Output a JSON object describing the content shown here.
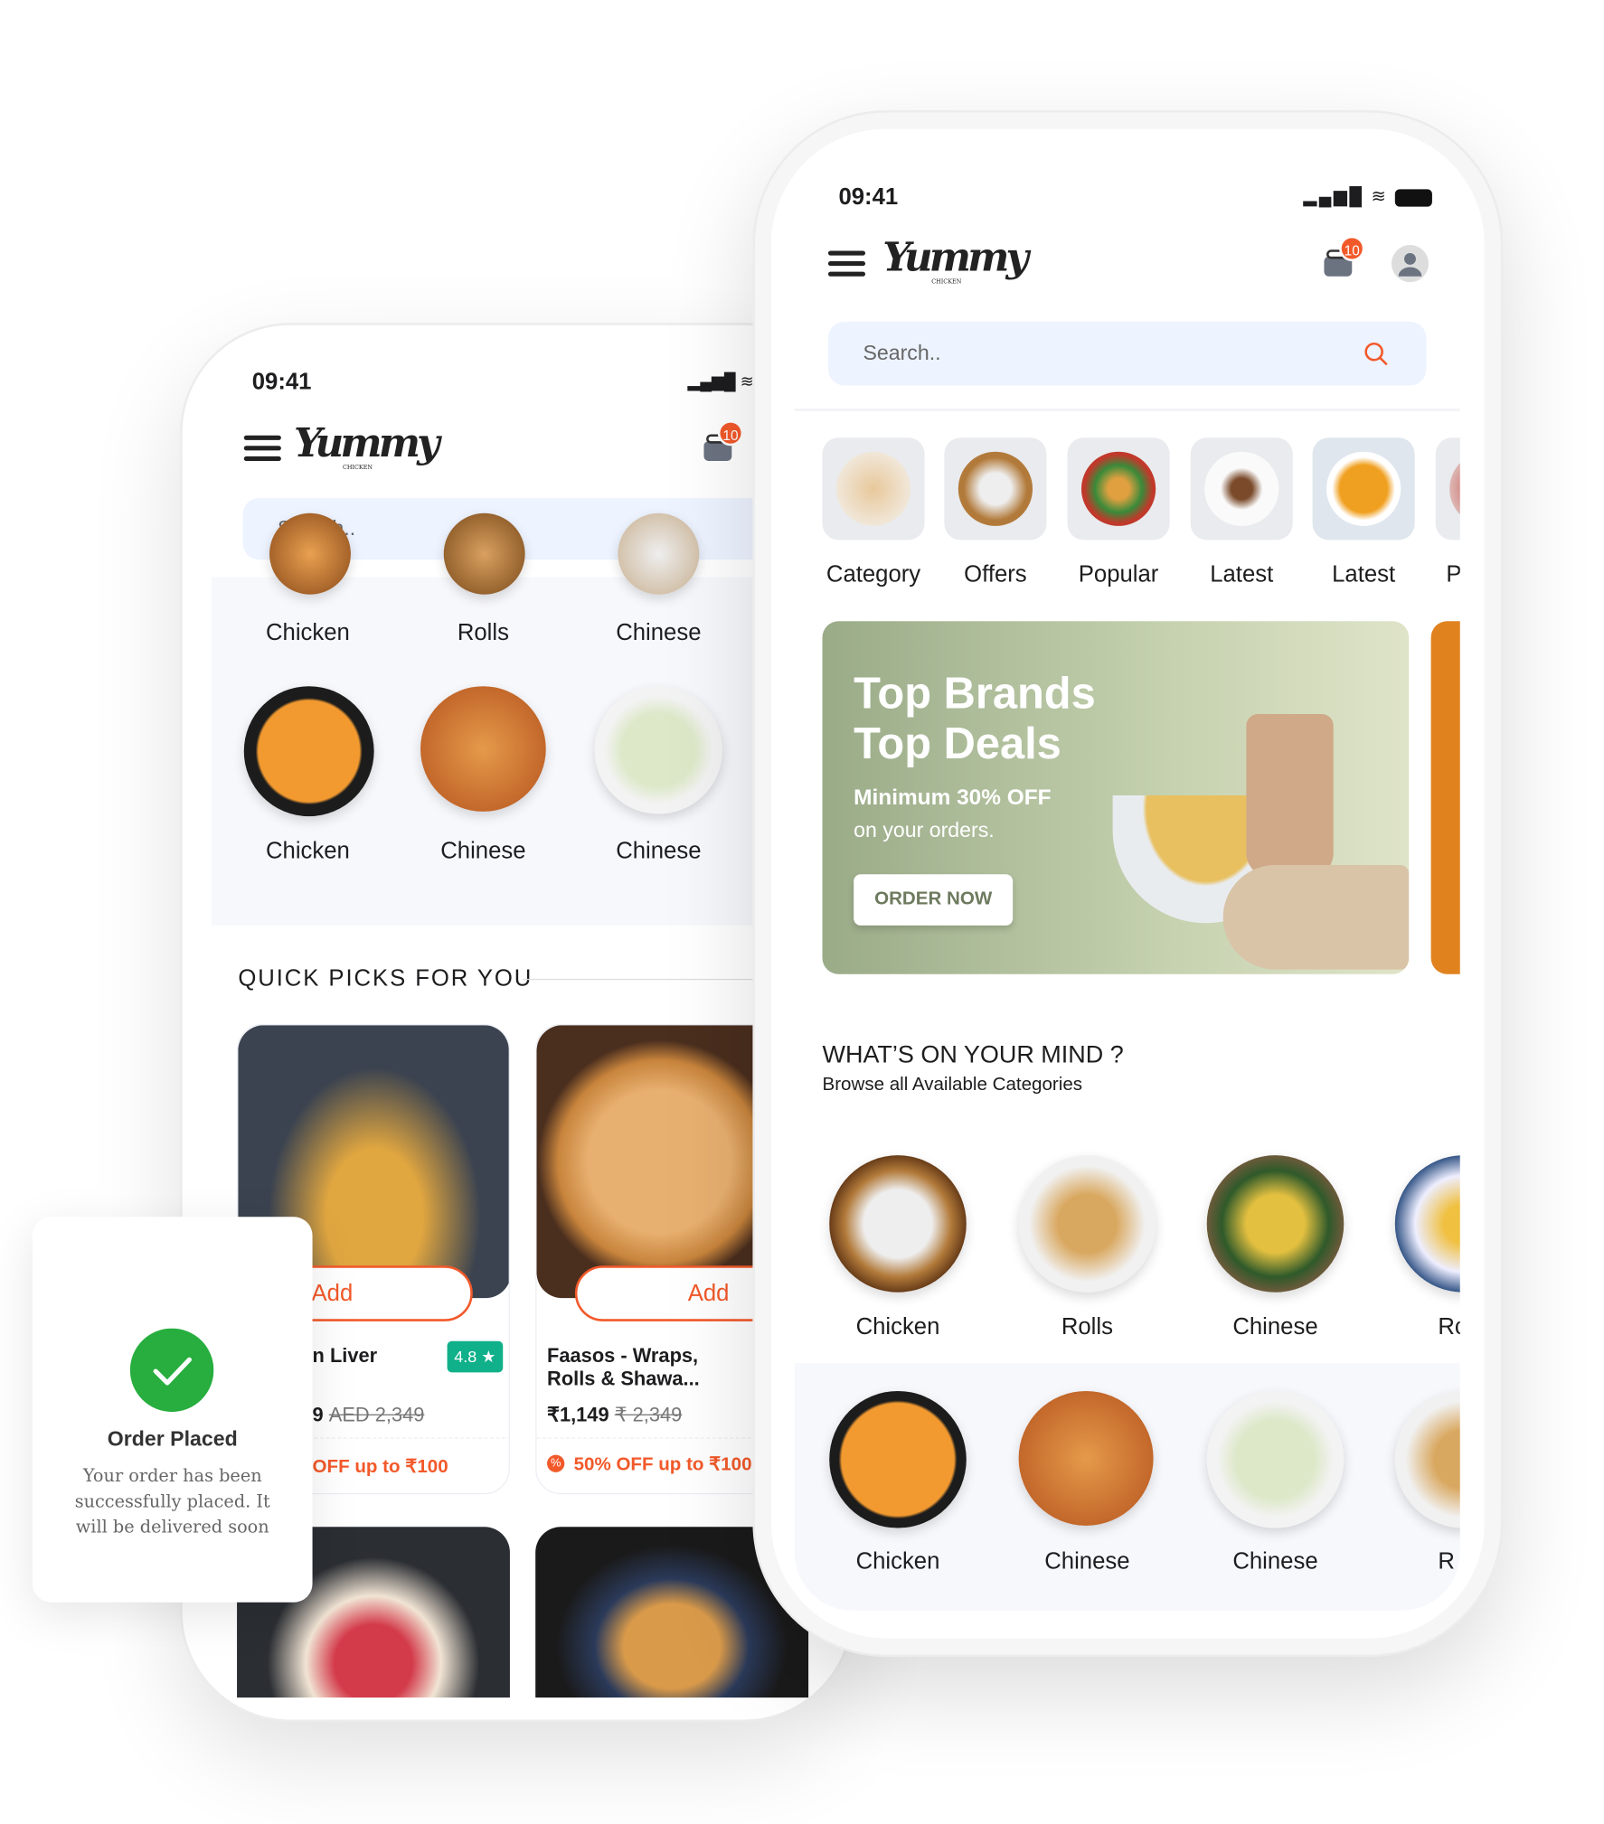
{
  "back_phone": {
    "status_time": "09:41",
    "logo_text": "Yummy",
    "logo_sub": "CHICKEN",
    "cart_count": "10",
    "search_placeholder": "Search..",
    "categories_row1": [
      "Chicken",
      "Rolls",
      "Chinese"
    ],
    "categories_row2": [
      "Chicken",
      "Chinese",
      "Chinese"
    ],
    "section_title": "QUICK PICKS FOR YOU",
    "cards": [
      {
        "title": "n Liver",
        "rating": "4.8",
        "price": "9",
        "old_price": "AED 2,349",
        "offer": "OFF up to ₹100",
        "add_label": "Add"
      },
      {
        "title": "Faasos - Wraps, Rolls & Shawa...",
        "price": "₹1,149",
        "old_price": "₹ 2,349",
        "offer": "50% OFF up to ₹100",
        "add_label": "Add"
      }
    ]
  },
  "front_phone": {
    "status_time": "09:41",
    "logo_text": "Yummy",
    "logo_sub": "CHICKEN",
    "cart_count": "10",
    "search_placeholder": "Search..",
    "top_categories": [
      "Category",
      "Offers",
      "Popular",
      "Latest",
      "Latest",
      "P"
    ],
    "banner": {
      "title_line1": "Top Brands",
      "title_line2": "Top Deals",
      "subtitle_bold": "Minimum 30% OFF",
      "subtitle": "on your orders.",
      "cta": "ORDER NOW"
    },
    "section_title": "WHAT’S ON YOUR MIND ?",
    "section_subtitle": "Browse all Available Categories",
    "categories_row1": [
      "Chicken",
      "Rolls",
      "Chinese",
      "Rc"
    ],
    "categories_row2": [
      "Chicken",
      "Chinese",
      "Chinese",
      "R"
    ]
  },
  "toast": {
    "title": "Order Placed",
    "message": "Your order has been successfully placed. It will be delivered soon",
    "icon": "check-icon",
    "color": "#27ae3e"
  },
  "colors": {
    "accent": "#f2592a",
    "rating": "#10b08a",
    "search_bg": "#edf3ff"
  }
}
